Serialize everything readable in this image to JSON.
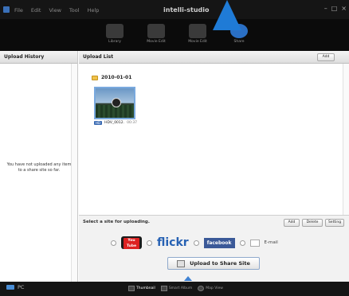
{
  "window": {
    "title": "intelli-studio"
  },
  "menu": [
    "File",
    "Edit",
    "View",
    "Tool",
    "Help"
  ],
  "toolbar": {
    "items": [
      {
        "label": "Library",
        "color": "#555"
      },
      {
        "label": "Movie Edit",
        "color": "#555"
      },
      {
        "label": "Movie Edit",
        "color": "#555"
      },
      {
        "label": "Share",
        "color": "#2a6fc4"
      }
    ]
  },
  "left_panel": {
    "title": "Upload History",
    "empty_text": "You have not uploaded any item to a share site so far."
  },
  "upload_list": {
    "title": "Upload List",
    "add_label": "Add",
    "folder": "2010-01-01",
    "item": {
      "badge": "HD",
      "name": "HDV_0012.",
      "duration": "00:37"
    }
  },
  "share": {
    "prompt": "Select a site for uploading.",
    "add_label": "Add",
    "delete_label": "Delete",
    "setting_label": "Setting",
    "youtube_label": "You Tube",
    "flickr_label": "flickr",
    "facebook_label": "facebook",
    "email_label": "E-mail",
    "upload_label": "Upload to Share Site"
  },
  "bottom": {
    "pc_label": "PC",
    "views": [
      "Thumbnail",
      "Smart Album",
      "Map View"
    ]
  }
}
